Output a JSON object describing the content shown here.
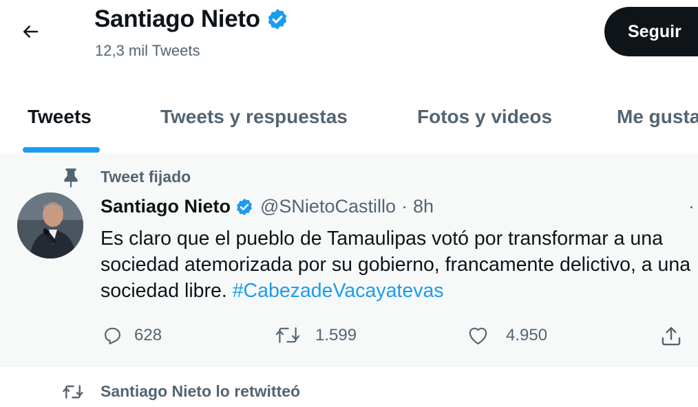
{
  "colors": {
    "accent": "#1d9bf0",
    "text": "#0f1419",
    "muted": "#536471",
    "pinned_bg": "#f7f9f9",
    "button_bg": "#0f1419"
  },
  "header": {
    "back_icon": "arrow-left-icon",
    "title": "Santiago Nieto",
    "verified_icon": "verified-badge-icon",
    "subtitle": "12,3 mil Tweets",
    "follow_label": "Seguir"
  },
  "tabs": [
    {
      "label": "Tweets",
      "active": true
    },
    {
      "label": "Tweets y respuestas",
      "active": false
    },
    {
      "label": "Fotos y videos",
      "active": false
    },
    {
      "label": "Me gusta",
      "active": false
    }
  ],
  "pinned_tweet": {
    "pin_icon": "pin-icon",
    "pinned_label": "Tweet fijado",
    "author_name": "Santiago Nieto",
    "handle": "@SNietoCastillo",
    "separator": "·",
    "time": "8h",
    "more": "·",
    "text": "Es claro que el pueblo de Tamaulipas votó por transformar a una sociedad atemorizada por su gobierno, francamente delictivo, a una sociedad libre.",
    "hashtag": "#CabezadeVacayatevas",
    "replies": "628",
    "retweets": "1.599",
    "likes": "4.950",
    "icons": {
      "reply": "reply-icon",
      "retweet": "retweet-icon",
      "like": "heart-icon",
      "share": "share-icon"
    }
  },
  "next_tweet": {
    "retweet_icon": "retweet-icon",
    "retweet_label": "Santiago Nieto lo retwitteó"
  }
}
